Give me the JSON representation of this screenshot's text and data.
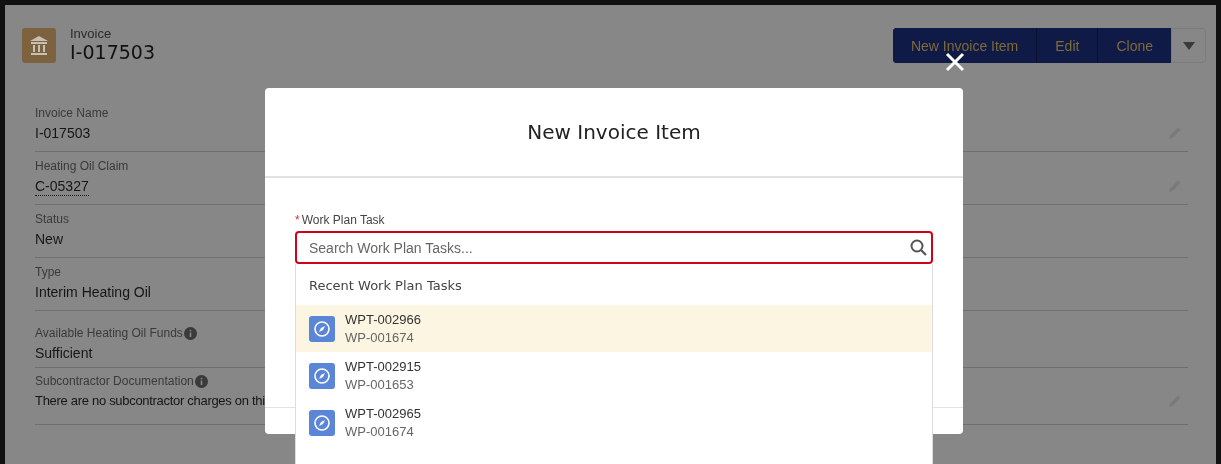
{
  "record": {
    "object": "Invoice",
    "name": "I-017503"
  },
  "actions": [
    {
      "label": "New Invoice Item"
    },
    {
      "label": "Edit"
    },
    {
      "label": "Clone"
    }
  ],
  "fields": [
    {
      "label": "Invoice Name",
      "value": "I-017503",
      "kind": "text",
      "info": false,
      "editable": true
    },
    {
      "label": "Heating Oil Claim",
      "value": "C-05327",
      "kind": "link",
      "info": false,
      "editable": true
    },
    {
      "label": "Status",
      "value": "New",
      "kind": "text",
      "info": false,
      "editable": false
    },
    {
      "label": "Type",
      "value": "Interim Heating Oil",
      "kind": "text",
      "info": false,
      "editable": false
    },
    {
      "label": "Available Heating Oil Funds",
      "value": "Sufficient",
      "kind": "text",
      "info": true,
      "editable": false
    },
    {
      "label": "Subcontractor Documentation",
      "value": "There are no subcontractor charges on thi",
      "kind": "text",
      "info": true,
      "editable": true
    }
  ],
  "modal": {
    "title": "New Invoice Item",
    "field": {
      "required_mark": "*",
      "label": "Work Plan Task",
      "placeholder": "Search Work Plan Tasks..."
    },
    "dropdown": {
      "heading": "Recent Work Plan Tasks",
      "items": [
        {
          "title": "WPT-002966",
          "subtitle": "WP-001674",
          "selected": true
        },
        {
          "title": "WPT-002915",
          "subtitle": "WP-001653",
          "selected": false
        },
        {
          "title": "WPT-002965",
          "subtitle": "WP-001674",
          "selected": false
        }
      ]
    }
  }
}
